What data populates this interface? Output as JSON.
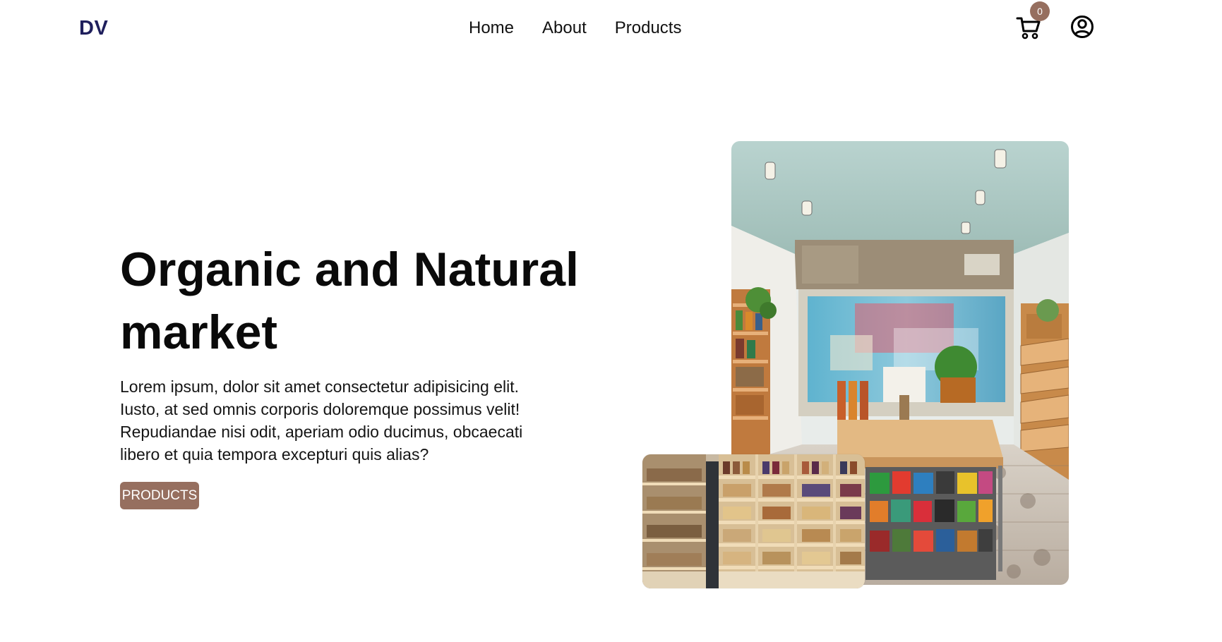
{
  "header": {
    "logo": "DV",
    "nav": {
      "home": "Home",
      "about": "About",
      "products": "Products"
    },
    "cart_count": "0",
    "cart_icon": "cart-icon",
    "user_icon": "user-circle-icon"
  },
  "hero": {
    "title": "Organic and Natural market",
    "description": "Lorem ipsum, dolor sit amet consectetur adipisicing elit. Iusto, at sed omnis corporis doloremque possimus velit! Repudiandae nisi odit, aperiam odio ducimus, obcaecati libero et quia tempora excepturi quis alias?",
    "button_label": "PRODUCTS"
  },
  "colors": {
    "accent": "#966f5f",
    "logo": "#1f1f5c",
    "text": "#111111",
    "background": "#ffffff"
  }
}
